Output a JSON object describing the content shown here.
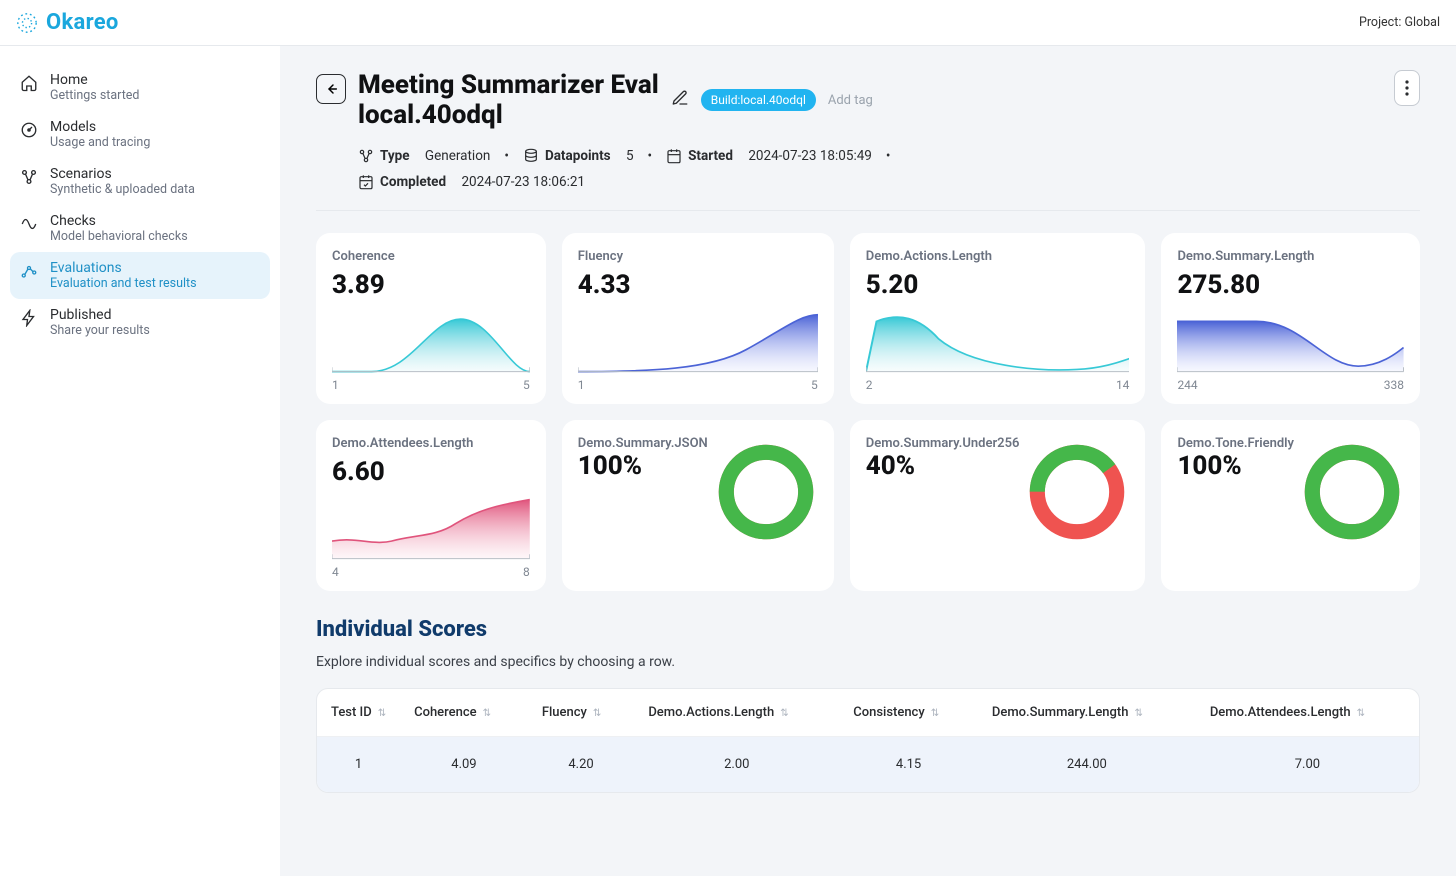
{
  "brand": {
    "name": "Okareo"
  },
  "project_label": "Project: Global",
  "sidebar": {
    "items": [
      {
        "id": "home",
        "title": "Home",
        "sub": "Gettings started",
        "icon": "home"
      },
      {
        "id": "models",
        "title": "Models",
        "sub": "Usage and tracing",
        "icon": "gauge"
      },
      {
        "id": "scenarios",
        "title": "Scenarios",
        "sub": "Synthetic & uploaded data",
        "icon": "branch"
      },
      {
        "id": "checks",
        "title": "Checks",
        "sub": "Model behavioral checks",
        "icon": "wave"
      },
      {
        "id": "evaluations",
        "title": "Evaluations",
        "sub": "Evaluation and test results",
        "icon": "graph"
      },
      {
        "id": "published",
        "title": "Published",
        "sub": "Share your results",
        "icon": "bolt"
      }
    ],
    "active_index": 4
  },
  "page": {
    "title_line1": "Meeting Summarizer Eval",
    "title_line2": "local.40odql",
    "tag": "Build:local.40odql",
    "add_tag_label": "Add tag",
    "meta": {
      "type_label": "Type",
      "type_value": "Generation",
      "datapoints_label": "Datapoints",
      "datapoints_value": "5",
      "started_label": "Started",
      "started_value": "2024-07-23 18:05:49",
      "completed_label": "Completed",
      "completed_value": "2024-07-23 18:06:21"
    }
  },
  "cards": [
    {
      "id": "coherence",
      "title": "Coherence",
      "value": "3.89",
      "kind": "spark",
      "min": "1",
      "max": "5",
      "color": "teal"
    },
    {
      "id": "fluency",
      "title": "Fluency",
      "value": "4.33",
      "kind": "spark",
      "min": "1",
      "max": "5",
      "color": "blue-right"
    },
    {
      "id": "actions-length",
      "title": "Demo.Actions.Length",
      "value": "5.20",
      "kind": "spark",
      "min": "2",
      "max": "14",
      "color": "teal-left"
    },
    {
      "id": "summary-length",
      "title": "Demo.Summary.Length",
      "value": "275.80",
      "kind": "spark",
      "min": "244",
      "max": "338",
      "color": "blue-plateau"
    },
    {
      "id": "attendees-length",
      "title": "Demo.Attendees.Length",
      "value": "6.60",
      "kind": "spark",
      "min": "4",
      "max": "8",
      "color": "pink"
    },
    {
      "id": "summary-json",
      "title": "Demo.Summary.JSON",
      "value": "100%",
      "kind": "donut",
      "pct": 100
    },
    {
      "id": "summary-under256",
      "title": "Demo.Summary.Under256",
      "value": "40%",
      "kind": "donut",
      "pct": 40
    },
    {
      "id": "tone-friendly",
      "title": "Demo.Tone.Friendly",
      "value": "100%",
      "kind": "donut",
      "pct": 100
    }
  ],
  "scores": {
    "title": "Individual Scores",
    "subtitle": "Explore individual scores and specifics by choosing a row.",
    "columns": [
      "Test ID",
      "Coherence",
      "Fluency",
      "Demo.Actions.Length",
      "Consistency",
      "Demo.Summary.Length",
      "Demo.Attendees.Length"
    ],
    "rows": [
      {
        "cells": [
          "1",
          "4.09",
          "4.20",
          "2.00",
          "4.15",
          "244.00",
          "7.00"
        ],
        "selected": true
      }
    ]
  },
  "chart_data": [
    {
      "metric": "Coherence",
      "type": "area",
      "x_range": [
        1,
        5
      ],
      "value": 3.89,
      "shape": "bell-center"
    },
    {
      "metric": "Fluency",
      "type": "area",
      "x_range": [
        1,
        5
      ],
      "value": 4.33,
      "shape": "rise-right"
    },
    {
      "metric": "Demo.Actions.Length",
      "type": "area",
      "x_range": [
        2,
        14
      ],
      "value": 5.2,
      "shape": "peak-left-tail-right"
    },
    {
      "metric": "Demo.Summary.Length",
      "type": "area",
      "x_range": [
        244,
        338
      ],
      "value": 275.8,
      "shape": "plateau-left-dip-rise"
    },
    {
      "metric": "Demo.Attendees.Length",
      "type": "area",
      "x_range": [
        4,
        8
      ],
      "value": 6.6,
      "shape": "rise-wavy"
    },
    {
      "metric": "Demo.Summary.JSON",
      "type": "donut",
      "pass_pct": 100
    },
    {
      "metric": "Demo.Summary.Under256",
      "type": "donut",
      "pass_pct": 40
    },
    {
      "metric": "Demo.Tone.Friendly",
      "type": "donut",
      "pass_pct": 100
    }
  ]
}
